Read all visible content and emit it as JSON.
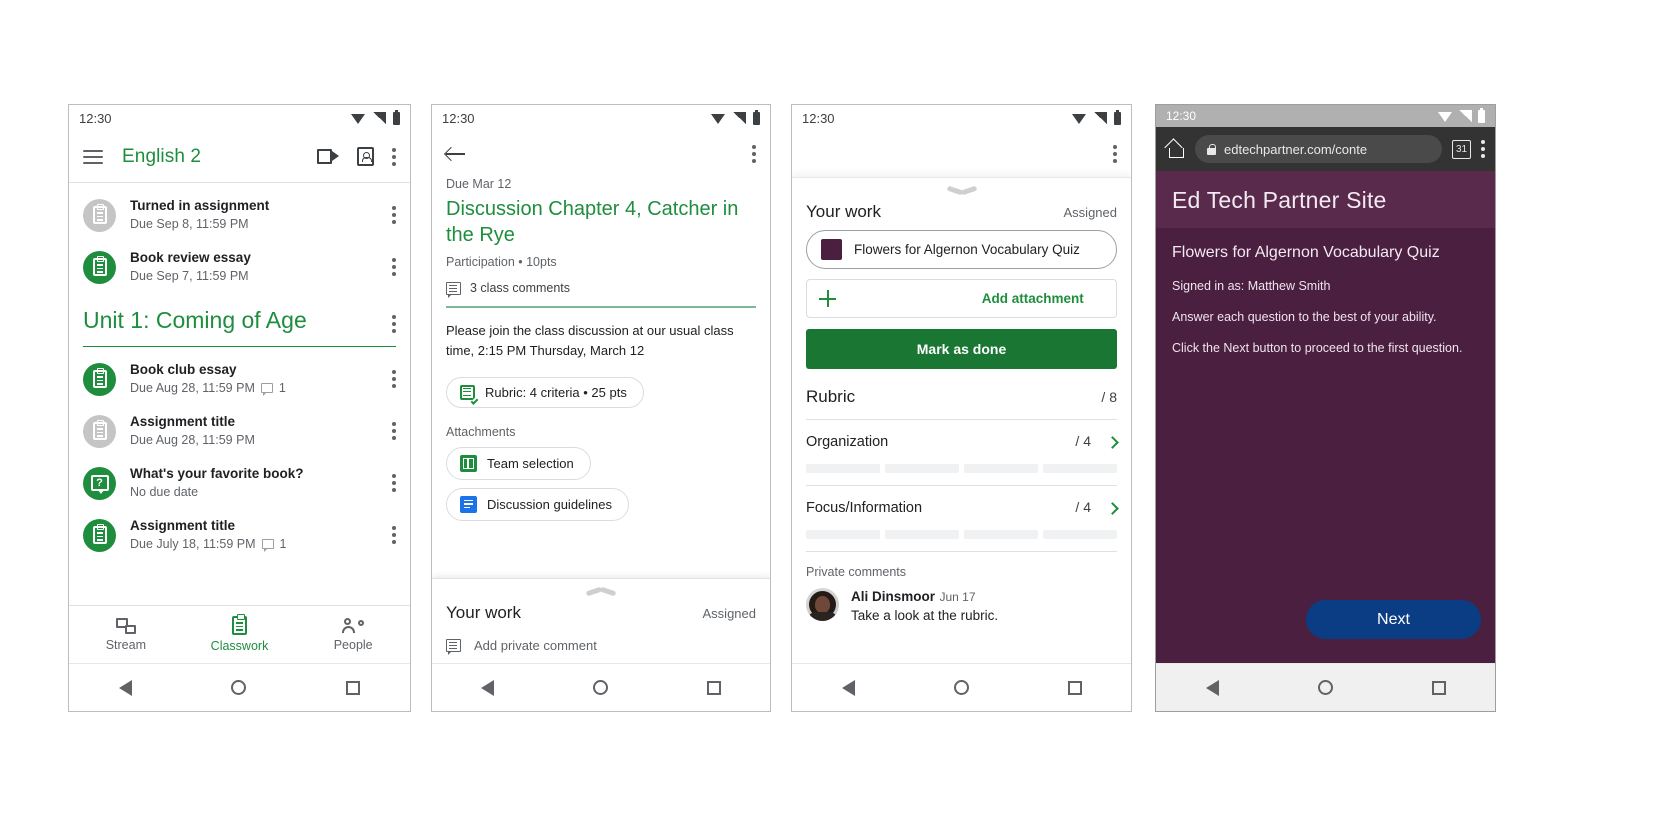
{
  "phone1": {
    "status": {
      "time": "12:30",
      "icons": [
        "wifi-icon",
        "signal-icon",
        "battery-icon"
      ]
    },
    "appbar": {
      "menu_icon": "hamburger-menu-icon",
      "title": "English 2",
      "video_icon": "video-camera-icon",
      "card_icon": "id-card-icon",
      "overflow_icon": "kebab-menu-icon"
    },
    "top_items": [
      {
        "title": "Turned in assignment",
        "sub": "Due Sep 8, 11:59 PM",
        "icon": "assignment-icon",
        "color": "grey",
        "comments": ""
      },
      {
        "title": "Book review essay",
        "sub": "Due Sep 7, 11:59 PM",
        "icon": "assignment-icon",
        "color": "green",
        "comments": ""
      }
    ],
    "unit": {
      "title": "Unit 1: Coming of Age",
      "overflow_icon": "kebab-menu-icon"
    },
    "unit_items": [
      {
        "title": "Book club essay",
        "sub": "Due Aug 28, 11:59 PM",
        "icon": "assignment-icon",
        "color": "green",
        "comments": "1"
      },
      {
        "title": "Assignment title",
        "sub": "Due Aug 28, 11:59 PM",
        "icon": "assignment-icon",
        "color": "grey",
        "comments": ""
      },
      {
        "title": "What's your favorite book?",
        "sub": "No due date",
        "icon": "question-icon",
        "color": "green",
        "comments": ""
      },
      {
        "title": "Assignment title",
        "sub": "Due July 18, 11:59 PM",
        "icon": "assignment-icon",
        "color": "green",
        "comments": "1"
      }
    ],
    "tabs": [
      {
        "label": "Stream",
        "icon": "stream-icon",
        "active": false
      },
      {
        "label": "Classwork",
        "icon": "classwork-icon",
        "active": true
      },
      {
        "label": "People",
        "icon": "people-icon",
        "active": false
      }
    ]
  },
  "phone2": {
    "status": {
      "time": "12:30"
    },
    "appbar": {
      "back_icon": "back-arrow-icon",
      "overflow_icon": "kebab-menu-icon"
    },
    "due": "Due Mar 12",
    "title": "Discussion Chapter 4, Catcher in the Rye",
    "meta": "Participation • 10pts",
    "class_comments": "3 class comments",
    "description": "Please join the class discussion at our usual class time, 2:15 PM Thursday, March 12",
    "rubric_chip": "Rubric: 4 criteria • 25 pts",
    "attachments_label": "Attachments",
    "attachments": [
      {
        "name": "Team selection",
        "icon": "google-sheets-icon"
      },
      {
        "name": "Discussion guidelines",
        "icon": "google-docs-icon"
      }
    ],
    "your_work": {
      "label": "Your work",
      "state": "Assigned"
    },
    "private_comment_placeholder": "Add private comment"
  },
  "phone3": {
    "status": {
      "time": "12:30"
    },
    "appbar": {
      "overflow_icon": "kebab-menu-icon"
    },
    "collapse_icon": "chevron-down-icon",
    "your_work": {
      "label": "Your work",
      "state": "Assigned"
    },
    "attachment": {
      "name": "Flowers for Algernon Vocabulary Quiz",
      "icon": "quiz-swatch-icon",
      "color": "#4a1f3f"
    },
    "add_attachment": "Add attachment",
    "mark_done": "Mark as done",
    "rubric": {
      "label": "Rubric",
      "total": "/ 8",
      "criteria": [
        {
          "name": "Organization",
          "score": "/ 4",
          "levels": 4
        },
        {
          "name": "Focus/Information",
          "score": "/ 4",
          "levels": 4
        }
      ]
    },
    "private_comments": {
      "label": "Private comments",
      "items": [
        {
          "author": "Ali Dinsmoor",
          "date": "Jun 17",
          "text": "Take a look at the rubric."
        }
      ]
    }
  },
  "phone4": {
    "status": {
      "time": "12:30"
    },
    "browser": {
      "home_icon": "home-icon",
      "lock_icon": "lock-icon",
      "url": "edtechpartner.com/conte",
      "tab_count": "31",
      "overflow_icon": "kebab-menu-icon"
    },
    "page": {
      "site_title": "Ed Tech Partner Site",
      "heading": "Flowers for Algernon Vocabulary Quiz",
      "lines": [
        "Signed in as: Matthew Smith",
        "Answer each question to the best of your ability.",
        "Click the Next button to proceed to the first question."
      ],
      "next_button": "Next",
      "bg_color": "#4a1f3f",
      "button_color": "#0b3d84"
    }
  },
  "android_nav": {
    "back": "back-triangle-icon",
    "home": "home-circle-icon",
    "recents": "recents-square-icon"
  }
}
